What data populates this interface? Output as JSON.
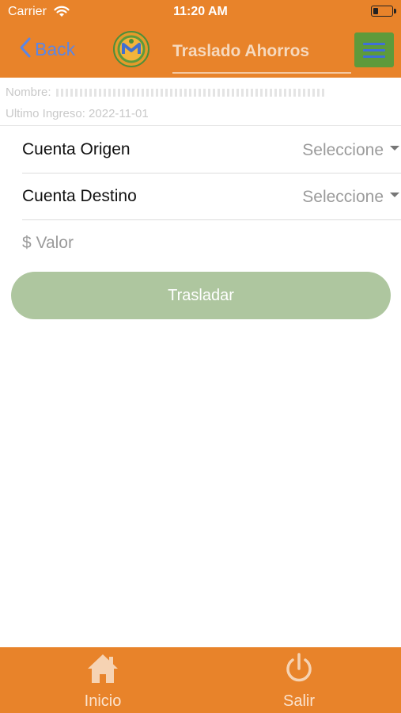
{
  "status_bar": {
    "carrier": "Carrier",
    "time": "11:20 AM"
  },
  "nav": {
    "back_label": "Back",
    "title": "Traslado Ahorros"
  },
  "user_info": {
    "name_label": "Nombre:",
    "last_login_label": "Ultimo Ingreso:",
    "last_login_value": "2022-11-01"
  },
  "form": {
    "origin": {
      "label": "Cuenta Origen",
      "value": "Seleccione"
    },
    "destination": {
      "label": "Cuenta Destino",
      "value": "Seleccione"
    },
    "amount": {
      "placeholder": "$ Valor",
      "value": ""
    },
    "submit_label": "Trasladar"
  },
  "tabbar": {
    "items": [
      {
        "label": "Inicio",
        "icon": "home-icon"
      },
      {
        "label": "Salir",
        "icon": "power-icon"
      }
    ]
  },
  "colors": {
    "brand_orange": "#E8832A",
    "menu_green": "#5E9A3B",
    "button_green": "#AEC69F",
    "back_blue": "#5B86E5"
  }
}
